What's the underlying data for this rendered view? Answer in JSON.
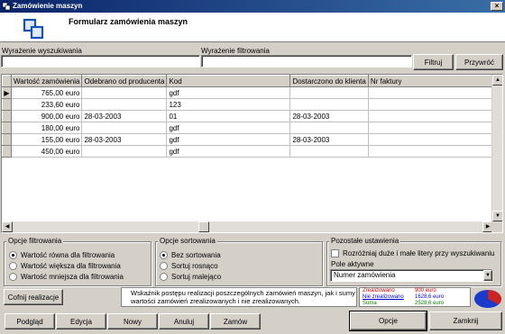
{
  "window": {
    "title": "Zamówienie maszyn",
    "close_glyph": "×"
  },
  "header": {
    "title": "Formularz zamówienia maszyn"
  },
  "search": {
    "label": "Wyrażenie wyszukiwania",
    "value": ""
  },
  "filter": {
    "label": "Wyrażenie filtrowania",
    "value": "",
    "filter_button": "Filtruj",
    "show_all_button": "Przywróć"
  },
  "grid": {
    "columns": [
      "Wartość zamówienia",
      "Odebrano od producenta",
      "Kod",
      "Dostarczono do klienta",
      "Nr faktury"
    ],
    "rows": [
      [
        "765,00 euro",
        "",
        "gdf",
        "",
        ""
      ],
      [
        "233,60 euro",
        "",
        "123",
        "",
        ""
      ],
      [
        "900,00 euro",
        "28-03-2003",
        "01",
        "28-03-2003",
        ""
      ],
      [
        "180,00 euro",
        "",
        "gdf",
        "",
        ""
      ],
      [
        "155,00 euro",
        "28-03-2003",
        "gdf",
        "28-03-2003",
        ""
      ],
      [
        "450,00 euro",
        "",
        "gdf",
        "",
        ""
      ]
    ],
    "current_row_indicator": "▶"
  },
  "filter_options": {
    "title": "Opcje filtrowania",
    "items": [
      "Wartość równa dla filtrowania",
      "Wartość większa dla filtrowania",
      "Wartość mniejsza dla filtrowania"
    ],
    "selected": 0
  },
  "sort_options": {
    "title": "Opcje sortowania",
    "items": [
      "Bez sortowania",
      "Sortuj rosnąco",
      "Sortuj malejąco"
    ],
    "selected": 0
  },
  "other_settings": {
    "title": "Pozostałe ustawienia",
    "case_sensitive_label": "Rozróżniaj duże i małe litery przy wyszukiwaniu",
    "case_sensitive_checked": false,
    "active_field_label": "Pole aktywne",
    "active_field_value": "Numer zamówienia"
  },
  "progress": {
    "undo_button": "Cofnij realizacje",
    "description": "Wskaźnik postępu realizacji poszczególnych zamówień maszyn, jak i sumy wartości zamówień zrealizowanych i nie zrealizowanych.",
    "legend": [
      {
        "label": "Zrealizowano",
        "value": "900 euro",
        "color": "#cc0000"
      },
      {
        "label": "Nie zrealizowano",
        "value": "1628,6 euro",
        "color": "#0000cc"
      },
      {
        "label": "Suma",
        "value": "2528,6 euro",
        "color": "#008000"
      }
    ],
    "pie_colors": {
      "done": "#cc2222",
      "not_done": "#1a3acc"
    },
    "done_fraction": 0.356
  },
  "buttons": {
    "preview": "Podgląd",
    "edit": "Edycja",
    "new": "Nowy",
    "cancel": "Anuluj",
    "order": "Zamów",
    "options": "Opcje",
    "close": "Zamknij"
  }
}
